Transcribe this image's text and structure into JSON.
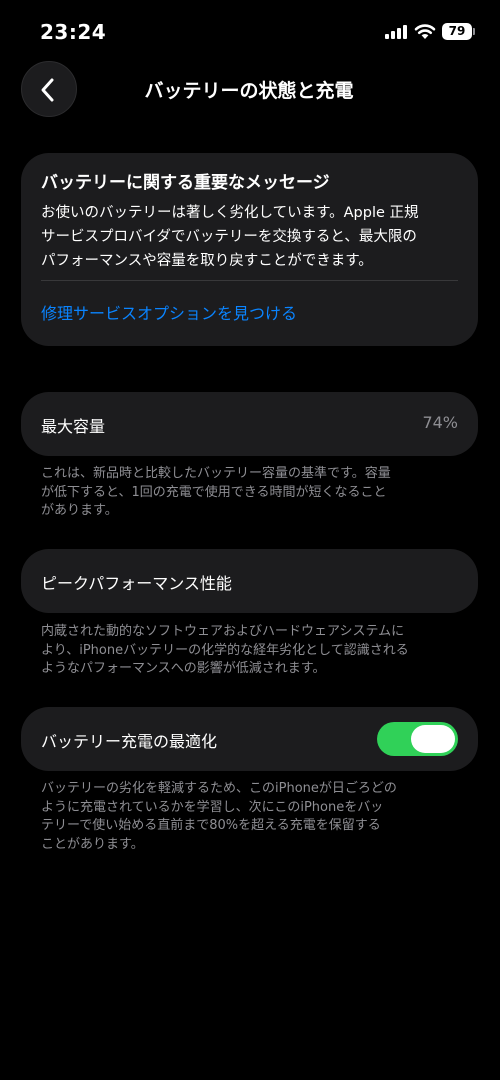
{
  "status": {
    "time": "23:24",
    "battery_level": "79"
  },
  "nav": {
    "title": "バッテリーの状態と充電"
  },
  "message": {
    "title": "バッテリーに関する重要なメッセージ",
    "body_lines": [
      "お使いのバッテリーは著しく劣化しています。Apple 正規",
      "サービスプロバイダでバッテリーを交換すると、最大限の",
      "パフォーマンスや容量を取り戻すことができます。"
    ],
    "link": "修理サービスオプションを見つける"
  },
  "max_capacity": {
    "label": "最大容量",
    "value": "74%",
    "note_lines": [
      "これは、新品時と比較したバッテリー容量の基準です。容量",
      "が低下すると、1回の充電で使用できる時間が短くなること",
      "があります。"
    ]
  },
  "peak_performance": {
    "label": "ピークパフォーマンス性能",
    "note_lines": [
      "内蔵された動的なソフトウェアおよびハードウェアシステムに",
      "より、iPhoneバッテリーの化学的な経年劣化として認識される",
      "ようなパフォーマンスへの影響が低減されます。"
    ]
  },
  "optimized_charging": {
    "label": "バッテリー充電の最適化",
    "enabled": true,
    "note_lines": [
      "バッテリーの劣化を軽減するため、このiPhoneが日ごろどの",
      "ように充電されているかを学習し、次にこのiPhoneをバッ",
      "テリーで使い始める直前まで80%を超える充電を保留する",
      "ことがあります。"
    ]
  },
  "colors": {
    "background": "#000000",
    "card": "#1c1c1e",
    "link": "#0a84ff",
    "toggle_on": "#30d158",
    "secondary_text": "#8e8e93"
  }
}
